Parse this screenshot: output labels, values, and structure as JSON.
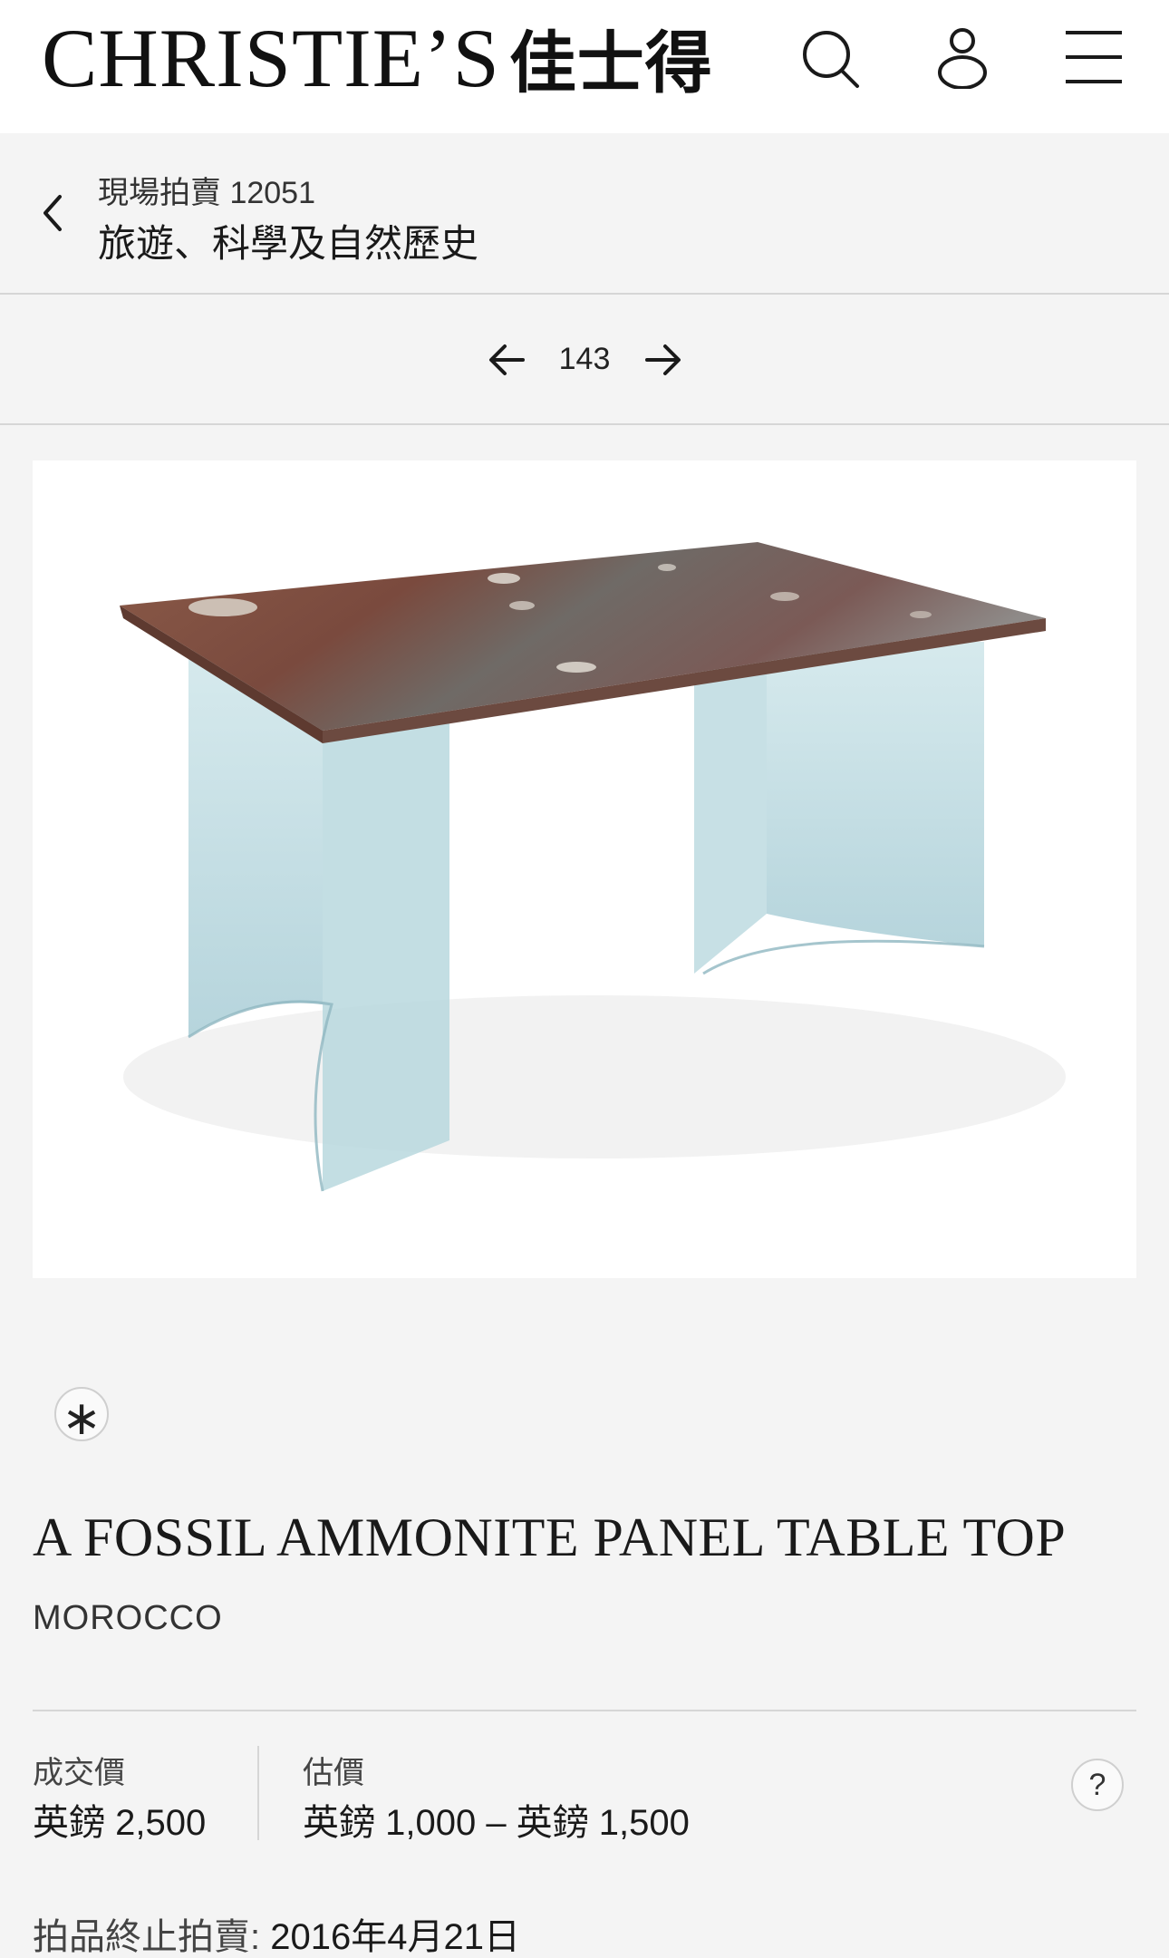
{
  "header": {
    "logo_text": "CHRISTIE’S",
    "logo_cjk": "佳士得",
    "icons": [
      "search-icon",
      "account-icon",
      "menu-icon"
    ]
  },
  "breadcrumb": {
    "sale_line": "現場拍賣 12051",
    "sale_title": "旅遊、科學及自然歷史"
  },
  "lot_nav": {
    "lot_number": "143"
  },
  "lot": {
    "badge_symbol": "∗",
    "title": "A FOSSIL AMMONITE PANEL TABLE TOP",
    "subtitle": "MOROCCO"
  },
  "price": {
    "realised_label": "成交價",
    "realised_value": "英鎊 2,500",
    "estimate_label": "估價",
    "estimate_value": "英鎊 1,000 – 英鎊 1,500",
    "help_symbol": "?"
  },
  "closing": {
    "label": "拍品終止拍賣:",
    "date": "2016年4月21日"
  },
  "colors": {
    "page_bg": "#f4f4f4",
    "header_bg": "#ffffff",
    "divider": "#d6d6d6",
    "text": "#1a1a1a"
  }
}
